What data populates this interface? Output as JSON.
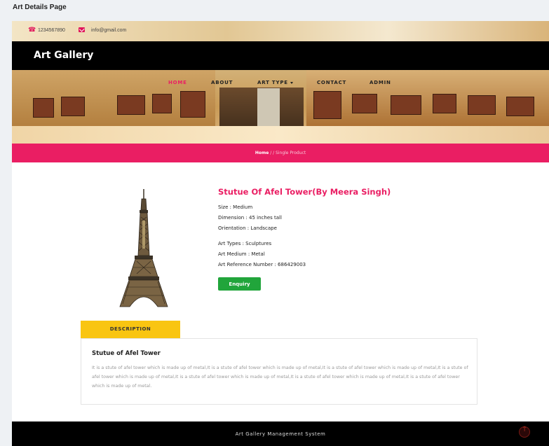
{
  "window": {
    "title": "Art Details Page"
  },
  "topbar": {
    "phone": "1234567890",
    "email": "info@gmail.com"
  },
  "brand": {
    "name": "Art Gallery"
  },
  "nav": {
    "items": [
      {
        "label": "HOME",
        "active": true
      },
      {
        "label": "ABOUT",
        "active": false
      },
      {
        "label": "ART TYPE",
        "active": false,
        "dropdown": true
      },
      {
        "label": "CONTACT",
        "active": false
      },
      {
        "label": "ADMIN",
        "active": false
      }
    ]
  },
  "breadcrumb": {
    "home": "Home",
    "separator": " / / ",
    "current": "Single Product"
  },
  "product": {
    "title": "Stutue Of Afel Tower(By Meera Singh)",
    "size": "Size : Medium",
    "dimension": "Dimension : 45 inches tall",
    "orientation": "Orientation : Landscape",
    "art_type": "Art Types : Sculptures",
    "medium": "Art Medium : Metal",
    "reference": "Art Reference Number : 686429003",
    "enquiry_label": "Enquiry"
  },
  "tabs": {
    "description_label": "DESCRIPTION"
  },
  "description": {
    "title": "Stutue of Afel Tower",
    "text": "It is a stute of afel tower which is made up of metal,It is a stute of afel tower which is made up of metal,It is a stute of afel tower which is made up of metal,It is a stute of afel tower which is made up of metal,It is a stute of afel tower which is made up of metal,It is a stute of afel tower which is made up of metal,It is a stute of afel tower which is made up of metal."
  },
  "footer": {
    "text": "Art Gallery Management System"
  },
  "colors": {
    "accent": "#ea1e63",
    "tab": "#f9c511",
    "button": "#21a53b",
    "nav_bg": "#000000"
  }
}
